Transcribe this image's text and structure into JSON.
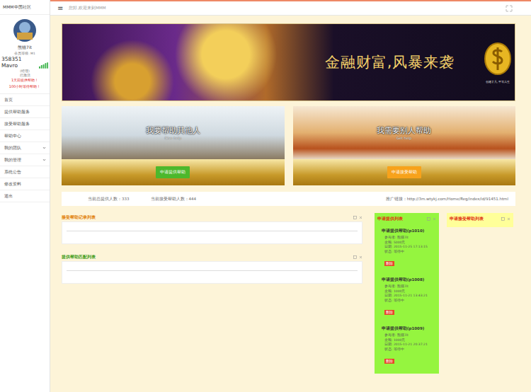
{
  "app": {
    "title": "MMM中国社区"
  },
  "profile": {
    "name": "熊猫7it",
    "level": "会员等级: M1",
    "balance": "358351 Mavro",
    "meta": [
      "(经理)",
      "已激活"
    ],
    "alerts": [
      "1天前提供帮助！",
      "100小时等待帮助！"
    ]
  },
  "menu": [
    {
      "label": "首页",
      "expandable": false,
      "selected": false
    },
    {
      "label": "提供帮助服务",
      "expandable": false,
      "selected": false
    },
    {
      "label": "接受帮助服务",
      "expandable": false,
      "selected": false
    },
    {
      "label": "帮助中心",
      "expandable": false,
      "selected": false
    },
    {
      "label": "我的团队",
      "expandable": true,
      "selected": false
    },
    {
      "label": "我的管理",
      "expandable": true,
      "selected": false
    },
    {
      "label": "系统公告",
      "expandable": false,
      "selected": false
    },
    {
      "label": "修改资料",
      "expandable": false,
      "selected": false
    },
    {
      "label": "退出",
      "expandable": false,
      "selected": false
    }
  ],
  "topbar": {
    "menu_icon": "≡",
    "breadcrumb": "您好,欢迎来到MMM"
  },
  "banner": {
    "slogan": "金融财富,风暴来袭",
    "tagline": "创建非凡,平等共生"
  },
  "actions": [
    {
      "title": "我要帮助其他人",
      "subtitle": "Give help",
      "button": "申请提供帮助",
      "color": "#4cb82c"
    },
    {
      "title": "我需要别人帮助",
      "subtitle": "Get help",
      "button": "申请接受帮助",
      "color": "#f7a21b"
    }
  ],
  "stats": [
    "当前总提供人数：333",
    "当前接受帮助人数：444",
    "推广链接：http://3m.wtykj.com/Home/Reg/index/id/91451.html"
  ],
  "panels": [
    {
      "title": "接受帮助记录列表",
      "color": "#e07b00"
    },
    {
      "title": "提供帮助匹配列表",
      "color": "#3a9a12"
    }
  ],
  "side_lists": [
    {
      "title": "申请提供列表",
      "color": "#95f53f",
      "items": [
        {
          "heading": "申请提供帮助(p1010)",
          "lines": [
            "参与者: 熊猫7it",
            "金额: 5000元",
            "日期: 2015-11-25 17:13:15",
            "状态: 等待中"
          ],
          "button": "删除"
        },
        {
          "heading": "申请提供帮助(p1008)",
          "lines": [
            "参与者: 熊猫7it",
            "金额: 1000元",
            "日期: 2015-11-21 13:43:21",
            "状态: 等待中"
          ],
          "button": "删除"
        },
        {
          "heading": "申请提供帮助(p1009)",
          "lines": [
            "参与者: 熊猫7it",
            "金额: 1000元",
            "日期: 2015-11-21 20:37:21",
            "状态: 等待中"
          ],
          "button": "删除"
        }
      ]
    },
    {
      "title": "申请接受帮助列表",
      "color": "#ffff99",
      "items": []
    }
  ]
}
